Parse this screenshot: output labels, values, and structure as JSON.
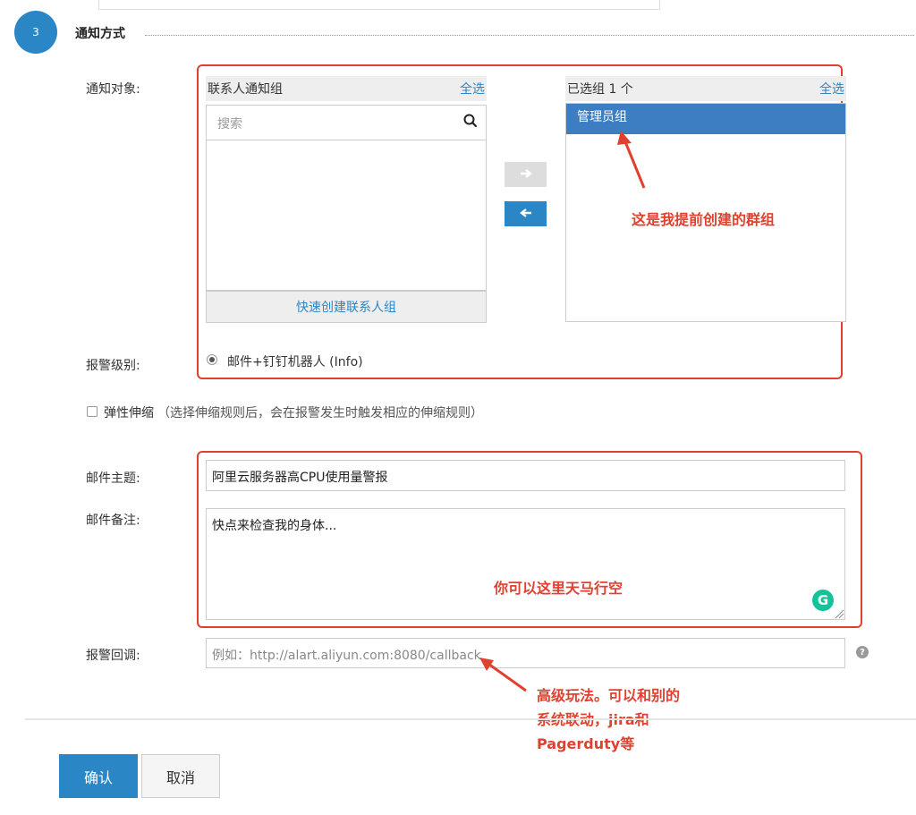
{
  "section": {
    "step_number": "3",
    "title": "通知方式"
  },
  "labels": {
    "notify_target": "通知对象:",
    "alert_level": "报警级别:",
    "email_subject": "邮件主题:",
    "email_note": "邮件备注:",
    "alert_callback": "报警回调:"
  },
  "contact_groups": {
    "title": "联系人通知组",
    "select_all": "全选",
    "search_placeholder": "搜索",
    "quick_create": "快速创建联系人组"
  },
  "selected_groups": {
    "title": "已选组 1 个",
    "select_all": "全选",
    "items": [
      "管理员组"
    ]
  },
  "alert_level_option": "邮件+钉钉机器人 (Info)",
  "elastic": {
    "label": "弹性伸缩",
    "hint": "（选择伸缩规则后，会在报警发生时触发相应的伸缩规则）"
  },
  "email_subject_value": "阿里云服务器高CPU使用量警报",
  "email_note_value": "快点来检查我的身体...",
  "callback_placeholder": "例如：http://alart.aliyun.com:8080/callback",
  "grammarly_letter": "G",
  "annotations": {
    "group_note": "这是我提前创建的群组",
    "free_note": "你可以这里天马行空",
    "callback_note_line1": "高级玩法。可以和别的",
    "callback_note_line2": "系统联动，jira和",
    "callback_note_line3": "Pagerduty等"
  },
  "buttons": {
    "confirm": "确认",
    "cancel": "取消"
  },
  "colors": {
    "accent": "#2b86c5",
    "annotation_red": "#e0412f",
    "selected_bg": "#3d7ec3"
  }
}
